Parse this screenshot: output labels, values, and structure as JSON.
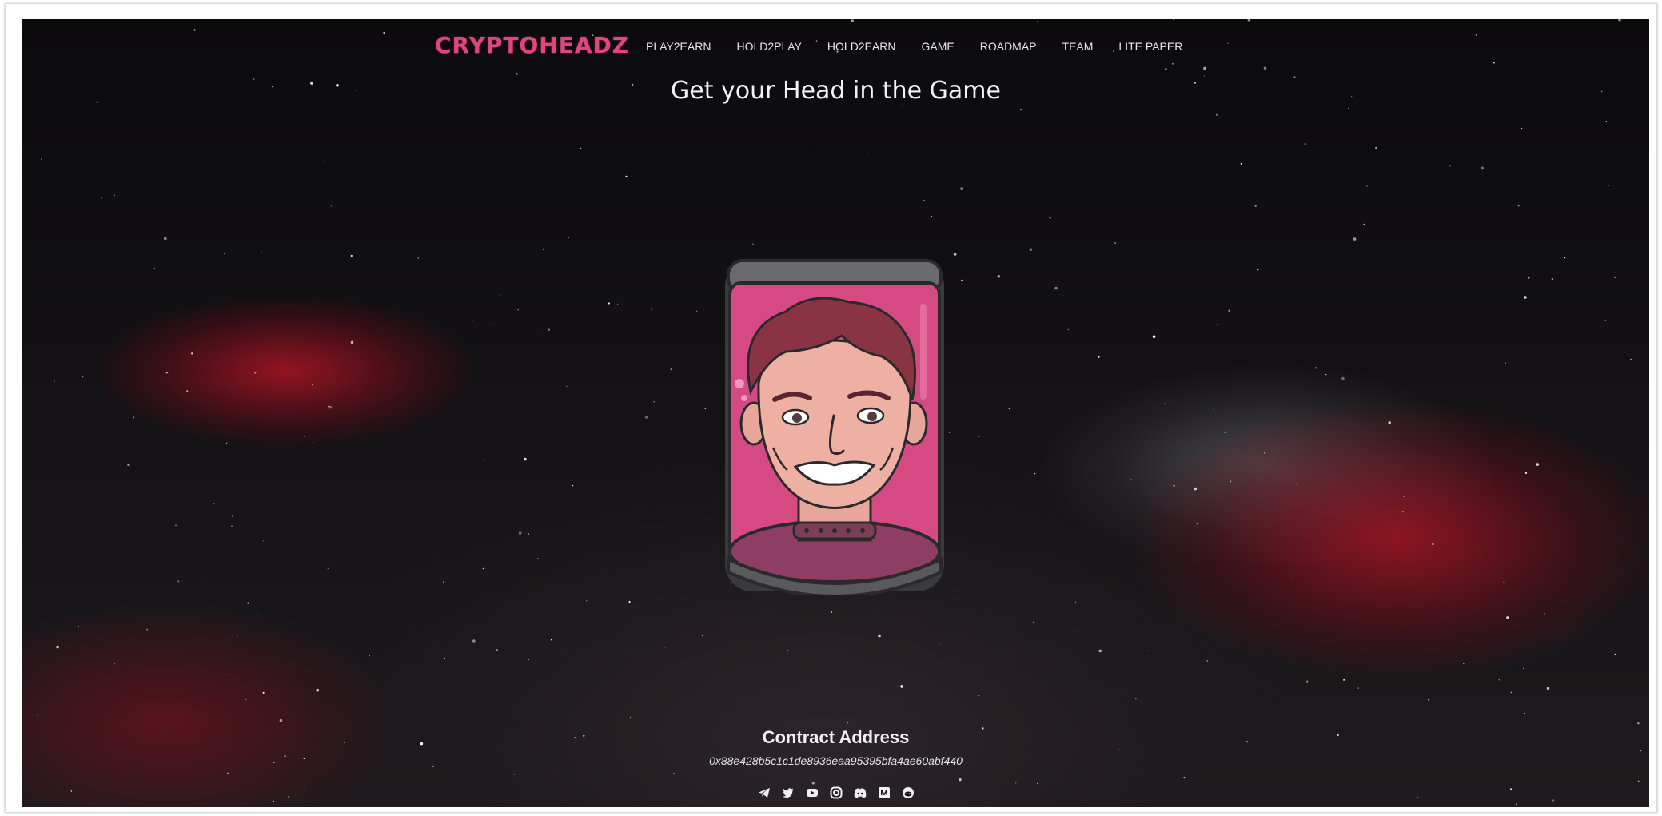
{
  "brand": {
    "logo_text": "CRYPTOHEADZ",
    "accent_color": "#e0457b"
  },
  "nav": {
    "items": [
      {
        "label": "PLAY2EARN"
      },
      {
        "label": "HOLD2PLAY"
      },
      {
        "label": "HOLD2EARN"
      },
      {
        "label": "GAME"
      },
      {
        "label": "ROADMAP"
      },
      {
        "label": "TEAM"
      },
      {
        "label": "LITE PAPER"
      }
    ]
  },
  "hero": {
    "title": "Get your Head in the Game",
    "image": "cartoon-head-in-jar"
  },
  "contract": {
    "title": "Contract Address",
    "address": "0x88e428b5c1c1de8936eaa95395bfa4ae60abf440"
  },
  "socials": [
    {
      "icon": "telegram-icon"
    },
    {
      "icon": "twitter-icon"
    },
    {
      "icon": "youtube-icon"
    },
    {
      "icon": "instagram-icon"
    },
    {
      "icon": "discord-icon"
    },
    {
      "icon": "medium-icon"
    },
    {
      "icon": "reddit-icon"
    }
  ]
}
